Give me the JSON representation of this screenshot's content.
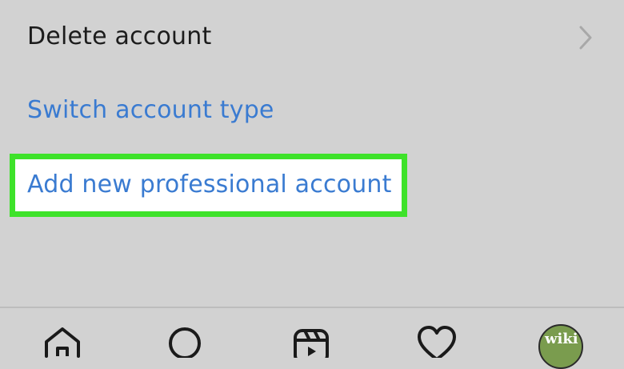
{
  "settings_menu": {
    "items": [
      {
        "label": "Delete account"
      },
      {
        "label": "Switch account type"
      },
      {
        "label": "Add new professional account"
      }
    ]
  },
  "tabbar": {
    "tabs": [
      {
        "icon": "home-icon"
      },
      {
        "icon": "search-icon"
      },
      {
        "icon": "reels-icon"
      },
      {
        "icon": "heart-icon"
      },
      {
        "icon": "profile-avatar"
      }
    ]
  },
  "avatar": {
    "watermark_text": "wiki"
  },
  "colors": {
    "background": "#d2d2d2",
    "link_blue": "#3a7bd1",
    "highlight_green": "#3ee22a",
    "text_dark": "#1c1c1c"
  }
}
